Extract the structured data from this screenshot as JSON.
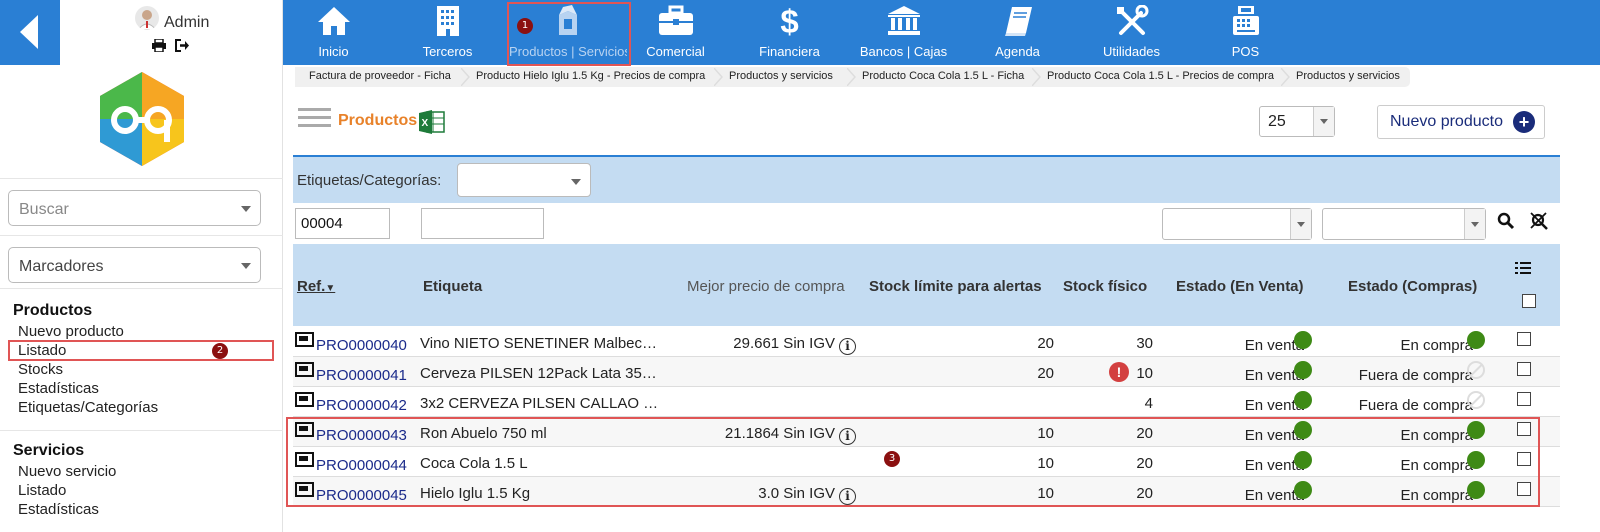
{
  "user": {
    "name": "Admin"
  },
  "nav": [
    {
      "label": "Inicio",
      "icon": "home-icon"
    },
    {
      "label": "Terceros",
      "icon": "building-icon"
    },
    {
      "label": "Productos | Servicios",
      "icon": "products-icon",
      "active": true
    },
    {
      "label": "Comercial",
      "icon": "briefcase-icon"
    },
    {
      "label": "Financiera",
      "icon": "dollar-icon"
    },
    {
      "label": "Bancos | Cajas",
      "icon": "bank-icon"
    },
    {
      "label": "Agenda",
      "icon": "book-icon"
    },
    {
      "label": "Utilidades",
      "icon": "tools-icon"
    },
    {
      "label": "POS",
      "icon": "cash-register-icon"
    }
  ],
  "breadcrumbs": [
    "Factura de proveedor - Ficha",
    "Producto Hielo Iglu 1.5 Kg - Precios de compra",
    "Productos y servicios",
    "Producto Coca Cola 1.5 L - Ficha",
    "Producto Coca Cola 1.5 L - Precios de compra",
    "Productos y servicios"
  ],
  "sidebar": {
    "search_placeholder": "Buscar",
    "bookmarks_label": "Marcadores",
    "sections": [
      {
        "title": "Productos",
        "items": [
          "Nuevo producto",
          "Listado",
          "Stocks",
          "Estadísticas",
          "Etiquetas/Categorías"
        ]
      },
      {
        "title": "Servicios",
        "items": [
          "Nuevo servicio",
          "Listado",
          "Estadísticas"
        ]
      }
    ]
  },
  "main": {
    "title": "Productos",
    "limit": "25",
    "new_product_label": "Nuevo producto",
    "filter_label": "Etiquetas/Categorías:",
    "ref_filter_value": "00004",
    "columns": {
      "ref": "Ref.",
      "label": "Etiqueta",
      "best_price": "Mejor precio de compra",
      "stock_limit": "Stock límite para alertas",
      "stock": "Stock físico",
      "status_sell": "Estado (En Venta)",
      "status_buy": "Estado (Compras)"
    },
    "rows": [
      {
        "ref": "PRO0000040",
        "label": "Vino NIETO SENETINER Malbec…",
        "price": "29.661 Sin IGV",
        "limit": "20",
        "stock": "30",
        "warn": false,
        "sell": "En venta",
        "buy": "En compra",
        "buy_on": true
      },
      {
        "ref": "PRO0000041",
        "label": "Cerveza PILSEN 12Pack Lata 35…",
        "price": "",
        "limit": "20",
        "stock": "10",
        "warn": true,
        "sell": "En venta",
        "buy": "Fuera de compra",
        "buy_on": false
      },
      {
        "ref": "PRO0000042",
        "label": "3x2 CERVEZA PILSEN CALLAO …",
        "price": "",
        "limit": "",
        "stock": "4",
        "warn": false,
        "sell": "En venta",
        "buy": "Fuera de compra",
        "buy_on": false
      },
      {
        "ref": "PRO0000043",
        "label": "Ron Abuelo 750 ml",
        "price": "21.1864 Sin IGV",
        "limit": "10",
        "stock": "20",
        "warn": false,
        "sell": "En venta",
        "buy": "En compra",
        "buy_on": true
      },
      {
        "ref": "PRO0000044",
        "label": "Coca Cola 1.5 L",
        "price": "",
        "limit": "10",
        "stock": "20",
        "warn": false,
        "sell": "En venta",
        "buy": "En compra",
        "buy_on": true
      },
      {
        "ref": "PRO0000045",
        "label": "Hielo Iglu 1.5 Kg",
        "price": "3.0 Sin IGV",
        "limit": "10",
        "stock": "20",
        "warn": false,
        "sell": "En venta",
        "buy": "En compra",
        "buy_on": true
      }
    ]
  },
  "markers": [
    "1",
    "2",
    "3"
  ],
  "colors": {
    "topbar": "#2a7fd4",
    "accent_title": "#e8822a",
    "status_on": "#3e8a15",
    "highlight": "#e05555"
  }
}
